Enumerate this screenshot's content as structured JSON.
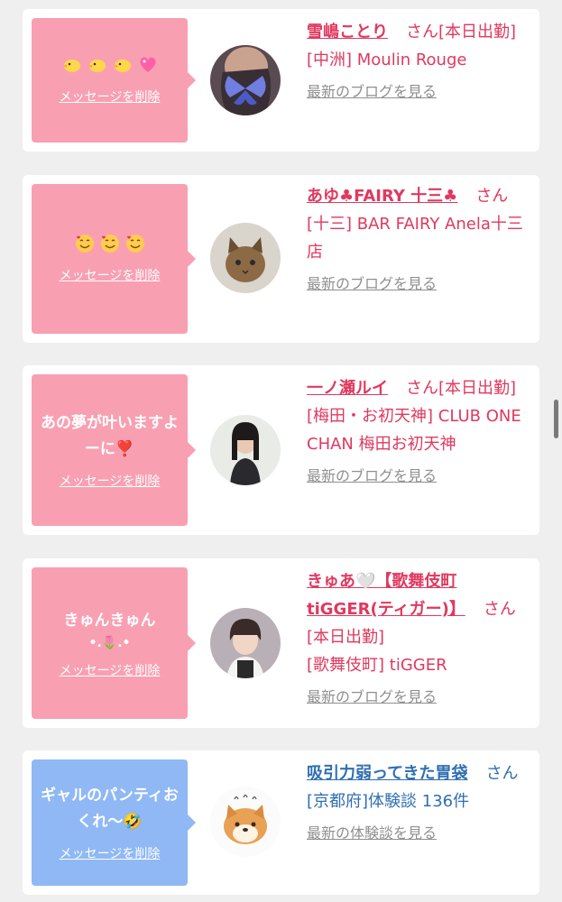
{
  "cards": [
    {
      "message": "",
      "delete_label": "メッセージを削除",
      "name": "雪嶋ことり",
      "suffix": "さん[本日出勤]",
      "place": "[中洲] Moulin Rouge",
      "link": "最新のブログを見る",
      "avatar_icon": "butterfly-avatar-icon"
    },
    {
      "message": "",
      "delete_label": "メッセージを削除",
      "name": "あゆ♣FAIRY 十三♣",
      "suffix": "さん",
      "place": "[十三] BAR FAIRY Anela十三店",
      "link": "最新のブログを見る",
      "avatar_icon": "cat-avatar-icon"
    },
    {
      "message": "あの夢が叶いますよーに❣️",
      "delete_label": "メッセージを削除",
      "name": "一ノ瀬ルイ",
      "suffix": "さん[本日出勤]",
      "place": "[梅田・お初天神] CLUB ONE CHAN 梅田お初天神",
      "link": "最新のブログを見る",
      "avatar_icon": "woman-avatar-icon"
    },
    {
      "message": "きゅんきゅん",
      "message_line2": "•.🌷.•",
      "delete_label": "メッセージを削除",
      "name": "きゅあ🤍【歌舞伎町tiGGER(ティガー)】",
      "suffix": "さん[本日出勤]",
      "place": "[歌舞伎町] tiGGER",
      "link": "最新のブログを見る",
      "avatar_icon": "girl-avatar-icon"
    },
    {
      "message": "ギャルのパンティおくれ〜🤣",
      "delete_label": "メッセージを削除",
      "name": "吸引力弱ってきた胃袋",
      "suffix": "さん",
      "place": "[京都府]体験談 136件",
      "link": "最新の体験談を見る",
      "avatar_icon": "shiba-dog-avatar-icon"
    }
  ],
  "colors": {
    "pink_bubble": "#f8a0b2",
    "blue_bubble": "#8fb8f5",
    "pink_text": "#e0395f",
    "blue_text": "#2f6fb2"
  }
}
